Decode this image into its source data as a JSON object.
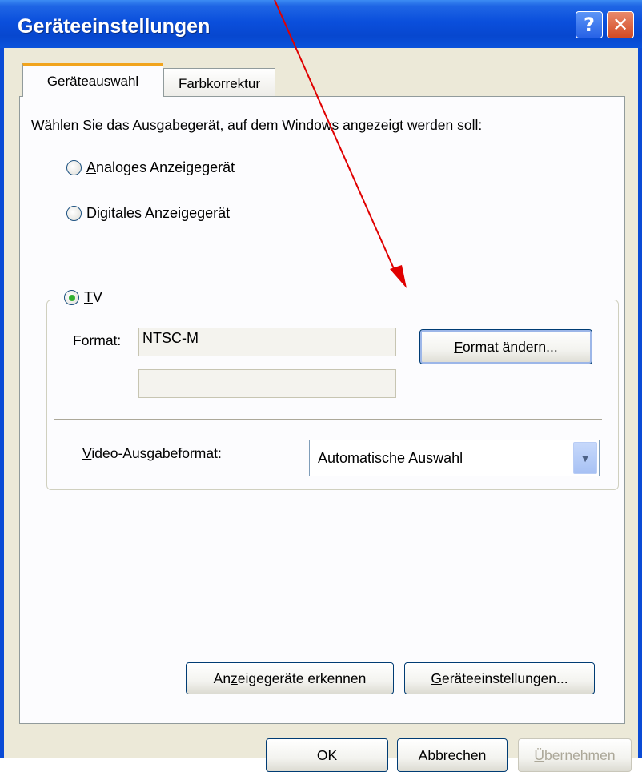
{
  "window": {
    "title": "Geräteeinstellungen",
    "help_glyph": "?",
    "close_glyph": "✕"
  },
  "tabs": [
    {
      "label": "Geräteauswahl",
      "active": true
    },
    {
      "label": "Farbkorrektur",
      "active": false
    }
  ],
  "panel": {
    "intro": "Wählen Sie das Ausgabegerät, auf dem Windows angezeigt werden soll:",
    "radios": [
      {
        "accel": "A",
        "rest": "naloges Anzeigegerät",
        "checked": false
      },
      {
        "accel": "D",
        "rest": "igitales Anzeigegerät",
        "checked": false
      },
      {
        "accel": "T",
        "rest": "V",
        "checked": true
      }
    ],
    "tv_group": {
      "format_label": "Format:",
      "format_value": "NTSC-M",
      "format_value_2": "",
      "change_format_button": {
        "accel": "F",
        "rest": "ormat ändern..."
      },
      "video_output_label": {
        "accel": "V",
        "rest": "ideo-Ausgabeformat:"
      },
      "video_output_selected": "Automatische Auswahl"
    },
    "detect_button": {
      "pre": "An",
      "accel": "z",
      "rest": "eigegeräte erkennen"
    },
    "settings_button": {
      "accel": "G",
      "rest": "eräteeinstellungen..."
    }
  },
  "footer": {
    "ok_label": "OK",
    "cancel_label": "Abbrechen",
    "apply_label": {
      "accel": "Ü",
      "rest": "bernehmen"
    }
  },
  "annotation": {
    "arrow_color": "#e00000"
  },
  "colors": {
    "titlebar": "#0a4bd6",
    "dialog_bg": "#ece9d8",
    "panel_bg": "#fcfcfe",
    "tab_highlight": "#f1a41d"
  }
}
